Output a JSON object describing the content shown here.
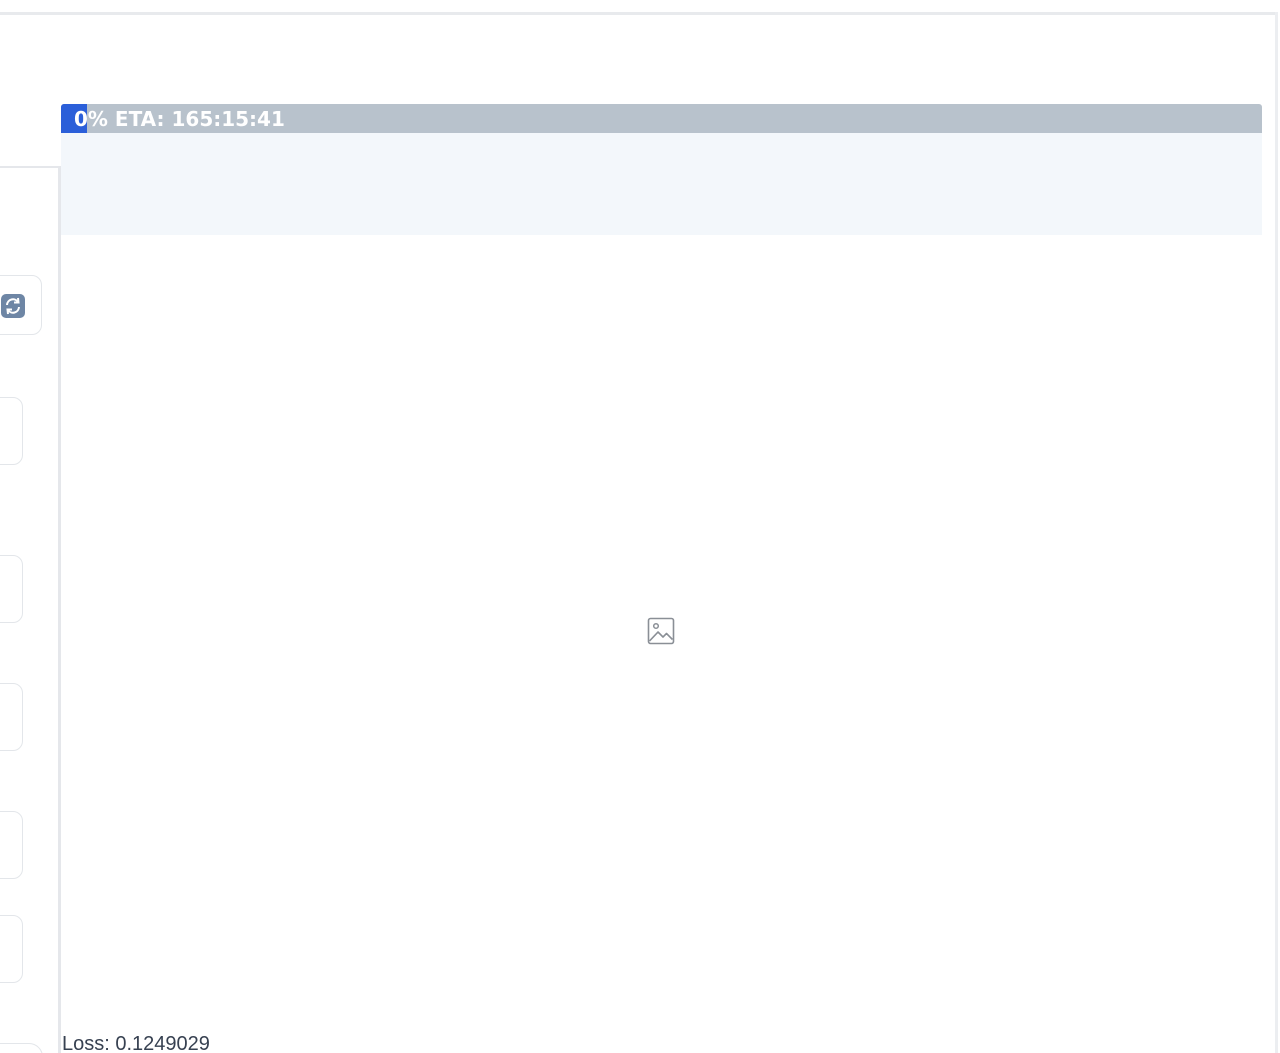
{
  "progress": {
    "percent": 0,
    "text": "0% ETA: 165:15:41",
    "fill_color": "#2b5fd9",
    "track_color": "#b8c2cc"
  },
  "output": {
    "image_icon": "image-icon",
    "loss_text": "Loss: 0.1249029"
  },
  "left_panel": {
    "refresh_icon": "refresh-icon"
  }
}
